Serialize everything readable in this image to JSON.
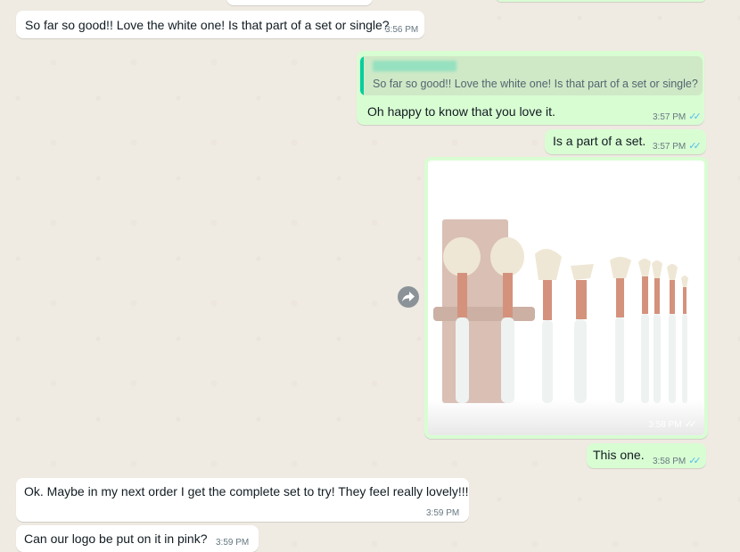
{
  "chat": {
    "messages": [
      {
        "direction": "incoming",
        "text": "So far so good!! Love the white one! Is that part of a set or single?",
        "time": "3:56 PM"
      },
      {
        "direction": "outgoing",
        "quote_text": "So far so good!! Love the white one! Is that part of a set or single?",
        "text": "Oh happy to know that you love it.",
        "time": "3:57 PM"
      },
      {
        "direction": "outgoing",
        "text": "Is a part of a set.",
        "time": "3:57 PM"
      },
      {
        "direction": "outgoing",
        "type": "image",
        "image_icon": "makeup-brush-set-photo",
        "time": "3:58 PM"
      },
      {
        "direction": "outgoing",
        "text": "This one.",
        "time": "3:58 PM"
      },
      {
        "direction": "incoming",
        "text": "Ok. Maybe in my next order I get the complete set to try! They feel really lovely!!!",
        "time": "3:59 PM"
      },
      {
        "direction": "incoming",
        "text": "Can our logo be put on it in pink?",
        "time": "3:59 PM"
      }
    ],
    "read_receipt_icon": "double-check-icon",
    "forward_icon": "forward-arrow-icon"
  },
  "colors": {
    "background": "#efeae2",
    "incoming_bubble": "#ffffff",
    "outgoing_bubble": "#d9fdd3",
    "read_ticks": "#53bdeb",
    "quote_bar": "#06cf9c"
  }
}
